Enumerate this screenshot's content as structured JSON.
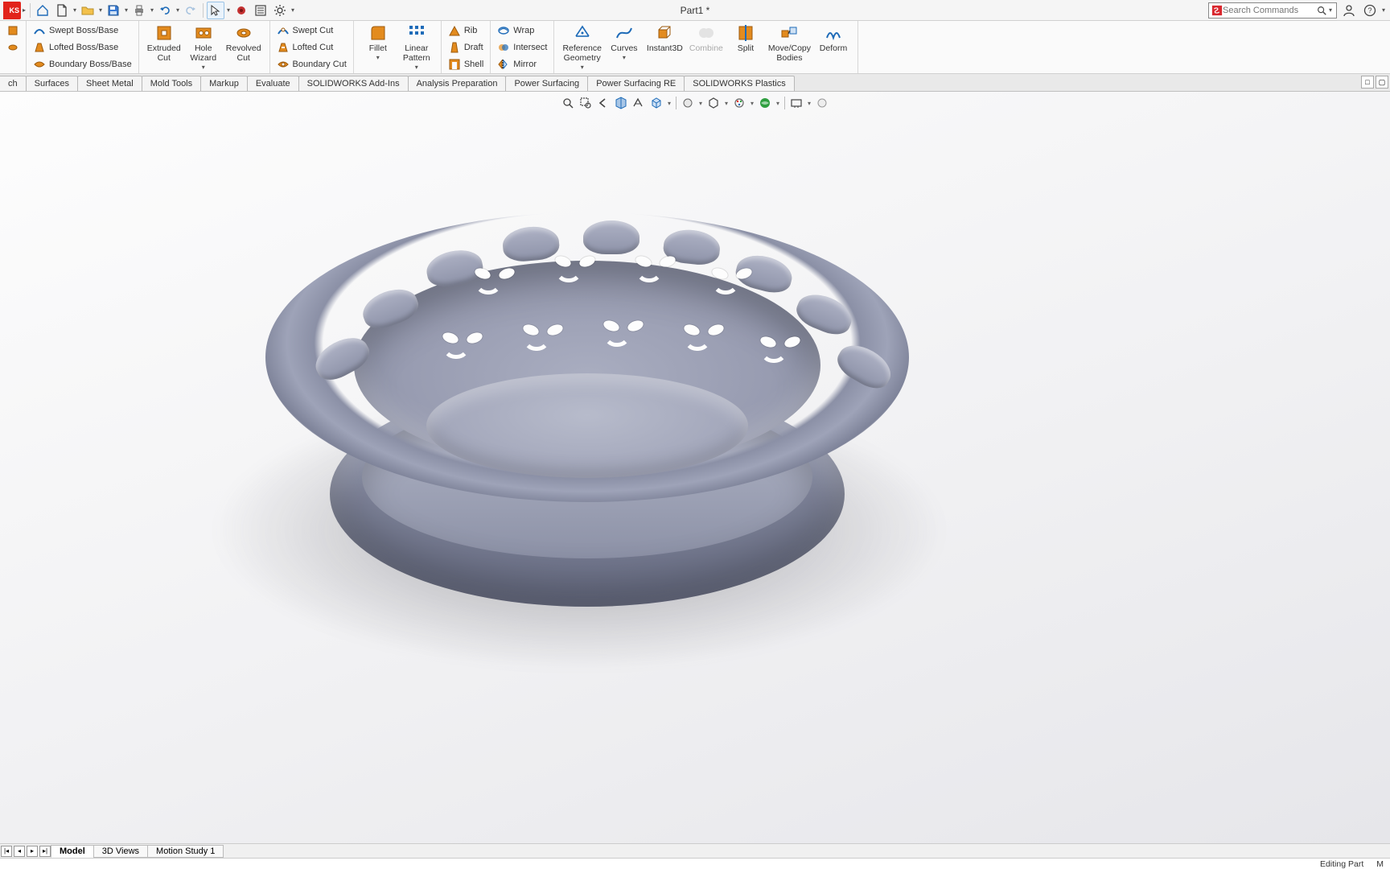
{
  "title": "Part1 *",
  "search": {
    "placeholder": "Search Commands"
  },
  "boss_rows": [
    {
      "label": "Swept Boss/Base"
    },
    {
      "label": "Lofted Boss/Base"
    },
    {
      "label": "Boundary Boss/Base"
    }
  ],
  "cut_big": [
    {
      "label": "Extruded\nCut"
    },
    {
      "label": "Hole\nWizard"
    },
    {
      "label": "Revolved\nCut"
    }
  ],
  "cut_rows": [
    {
      "label": "Swept Cut"
    },
    {
      "label": "Lofted Cut"
    },
    {
      "label": "Boundary Cut"
    }
  ],
  "feat_big": [
    {
      "label": "Fillet"
    },
    {
      "label": "Linear\nPattern"
    }
  ],
  "feat_rows": [
    {
      "label": "Rib"
    },
    {
      "label": "Draft"
    },
    {
      "label": "Shell"
    }
  ],
  "feat_rows2": [
    {
      "label": "Wrap"
    },
    {
      "label": "Intersect"
    },
    {
      "label": "Mirror"
    }
  ],
  "ref_big": [
    {
      "label": "Reference\nGeometry"
    },
    {
      "label": "Curves"
    },
    {
      "label": "Instant3D"
    },
    {
      "label": "Combine",
      "disabled": true
    },
    {
      "label": "Split"
    },
    {
      "label": "Move/Copy\nBodies"
    },
    {
      "label": "Deform"
    }
  ],
  "tabs": [
    "ch",
    "Surfaces",
    "Sheet Metal",
    "Mold Tools",
    "Markup",
    "Evaluate",
    "SOLIDWORKS Add-Ins",
    "Analysis Preparation",
    "Power Surfacing",
    "Power Surfacing RE",
    "SOLIDWORKS Plastics"
  ],
  "bottom_tabs": {
    "active": "Model",
    "others": [
      "3D Views",
      "Motion Study 1"
    ]
  },
  "status": {
    "mode": "Editing Part",
    "units": "M"
  }
}
